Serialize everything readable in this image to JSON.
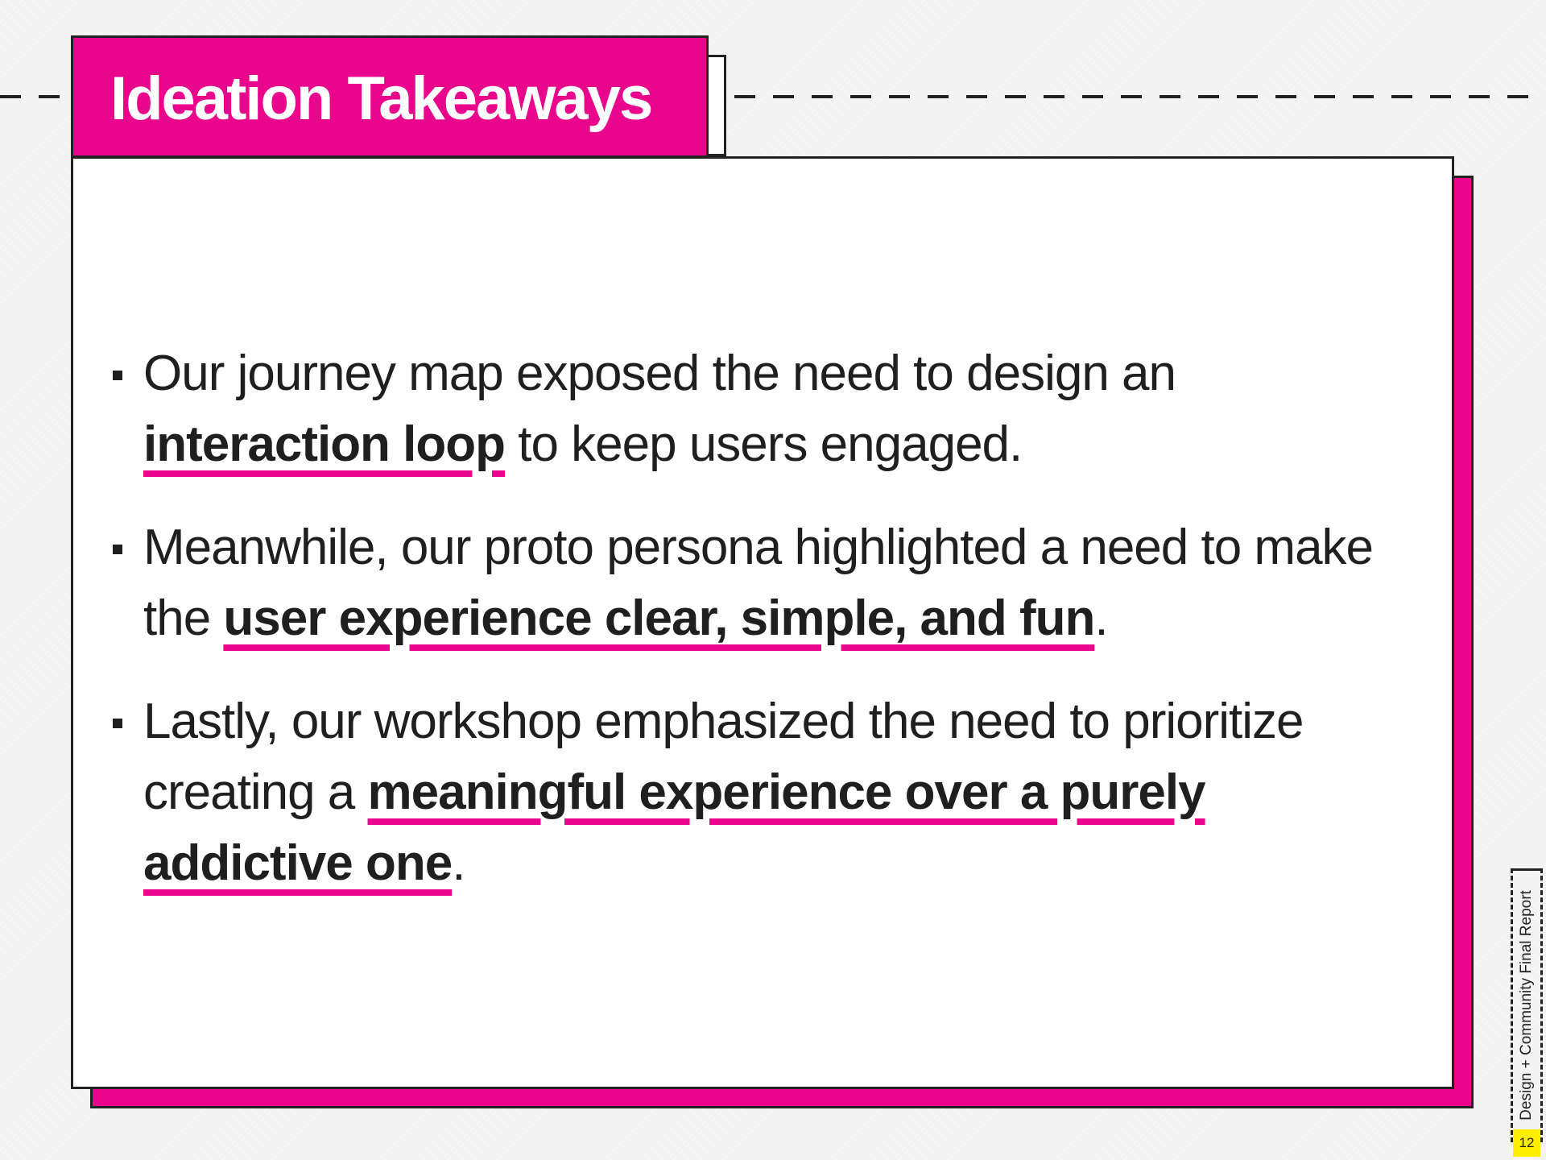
{
  "slide": {
    "title": "Ideation Takeaways",
    "bullets": [
      {
        "before": "Our journey map exposed the need to design an ",
        "highlight": "interaction loop",
        "after": " to keep users engaged."
      },
      {
        "before": "Meanwhile, our proto persona highlighted a need to make the ",
        "highlight": "user experience clear, simple, and fun",
        "after": "."
      },
      {
        "before": "Lastly, our workshop emphasized the need to prioritize creating a ",
        "highlight": "meaningful experience over a purely addictive one",
        "after": "."
      }
    ]
  },
  "footer": {
    "report_label": "Design + Community Final Report",
    "page_number": "12"
  },
  "colors": {
    "accent": "#ea068c",
    "text": "#1f1f1f",
    "page_badge": "#ffee00"
  }
}
